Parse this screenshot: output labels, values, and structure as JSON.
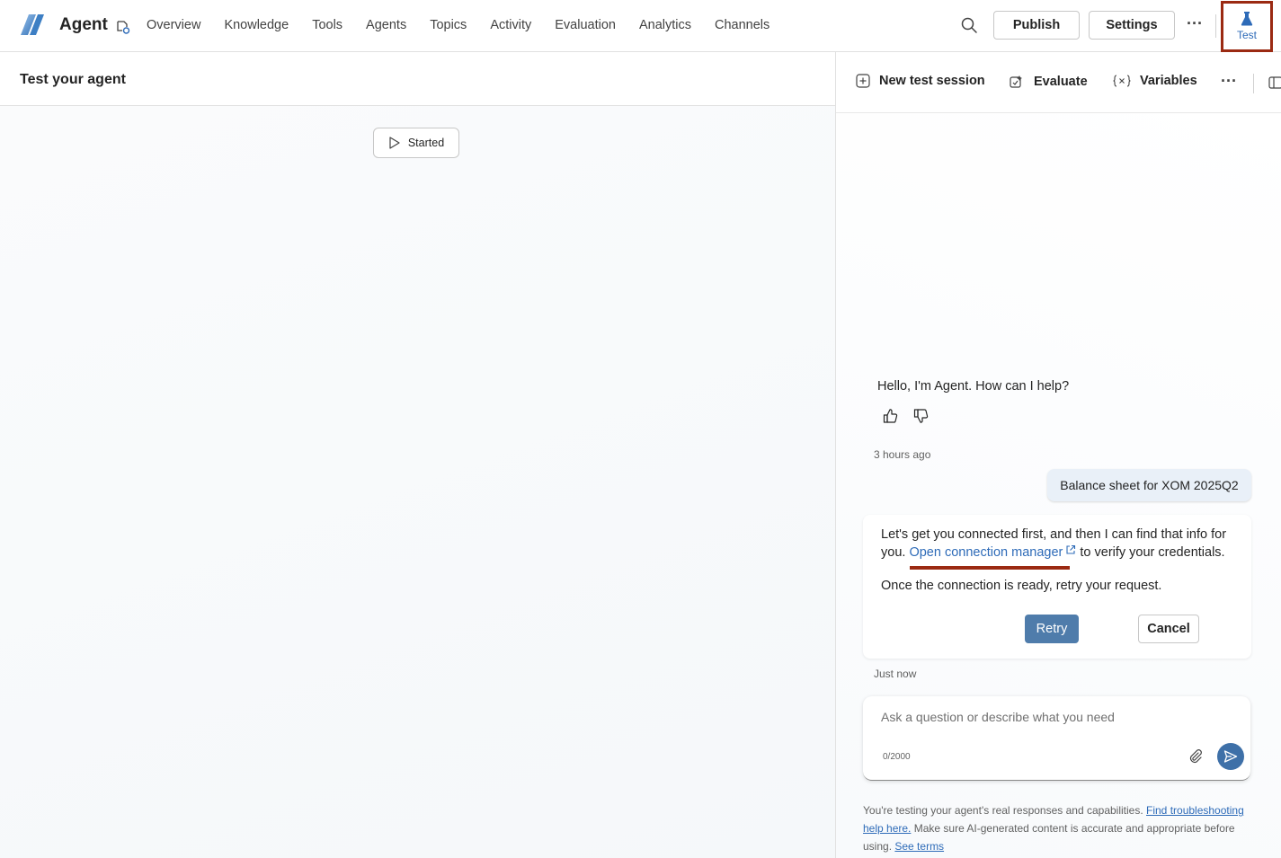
{
  "app": {
    "name": "Agent"
  },
  "nav": {
    "items": [
      {
        "label": "Overview"
      },
      {
        "label": "Knowledge"
      },
      {
        "label": "Tools"
      },
      {
        "label": "Agents"
      },
      {
        "label": "Topics"
      },
      {
        "label": "Activity"
      },
      {
        "label": "Evaluation"
      },
      {
        "label": "Analytics"
      },
      {
        "label": "Channels"
      }
    ],
    "publish_label": "Publish",
    "settings_label": "Settings",
    "more_label": "···",
    "test_label": "Test"
  },
  "left": {
    "title": "Test your agent",
    "started_label": "Started"
  },
  "toolbar": {
    "new_session_label": "New test session",
    "evaluate_label": "Evaluate",
    "variables_label": "Variables",
    "more_label": "···"
  },
  "chat": {
    "greeting": "Hello, I'm Agent. How can I help?",
    "greeting_time": "3 hours ago",
    "user_message": "Balance sheet for XOM 2025Q2",
    "bot_line1": "Let's get you connected first, and then I can find that info for",
    "bot_line2_prefix": "you.",
    "bot_link": "Open connection manager",
    "bot_line2_suffix": "to verify your credentials.",
    "bot_line3": "Once the connection is ready, retry your request.",
    "retry_label": "Retry",
    "cancel_label": "Cancel",
    "reply_time": "Just now"
  },
  "composer": {
    "placeholder": "Ask a question or describe what you need",
    "value": "",
    "char_count": "0/2000"
  },
  "disclaimer": {
    "text1": "You're testing your agent's real responses and capabilities.",
    "link1": "Find troubleshooting help here.",
    "text2": "Make sure AI-generated content is accurate and appropriate before using.",
    "link2": "See terms"
  },
  "colors": {
    "accent": "#2e6bb8",
    "highlight": "#9b2a12",
    "retry": "#4f7cab",
    "send": "#3e70a8",
    "user_bubble": "#e9f0f8"
  },
  "icons": [
    "logo-icon",
    "edit-icon",
    "search-icon",
    "flask-icon",
    "play-icon",
    "add-square-icon",
    "evaluate-icon",
    "variables-icon",
    "panel-icon",
    "thumbs-up-icon",
    "thumbs-down-icon",
    "external-link-icon",
    "attach-icon",
    "send-icon"
  ]
}
